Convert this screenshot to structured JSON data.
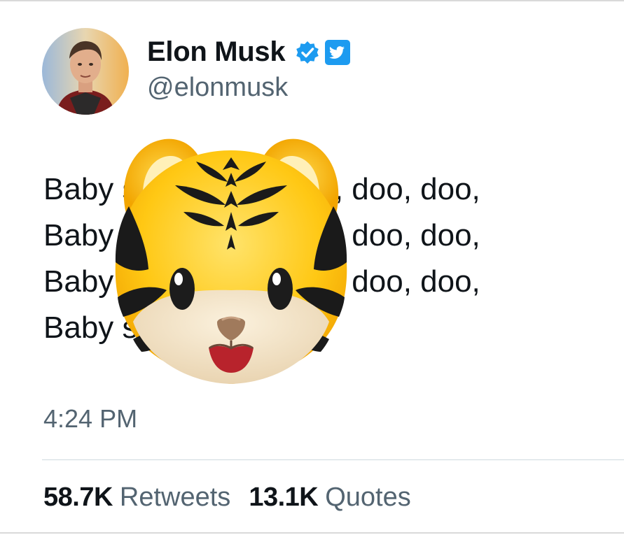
{
  "author": {
    "name": "Elon Musk",
    "handle": "@elonmusk",
    "verified_color": "#1d9bf0"
  },
  "tweet": {
    "lines": [
      "Baby shark, doo, doo, doo, doo,",
      "Baby shark, doo, doo, doo, doo,",
      "Baby shark, doo, doo, doo, doo,",
      "Baby shark"
    ],
    "overlay_emoji": "tiger-face",
    "timestamp": "4:24 PM"
  },
  "stats": {
    "retweets_count": "58.7K",
    "retweets_label": "Retweets",
    "quotes_count": "13.1K",
    "quotes_label": "Quotes"
  }
}
